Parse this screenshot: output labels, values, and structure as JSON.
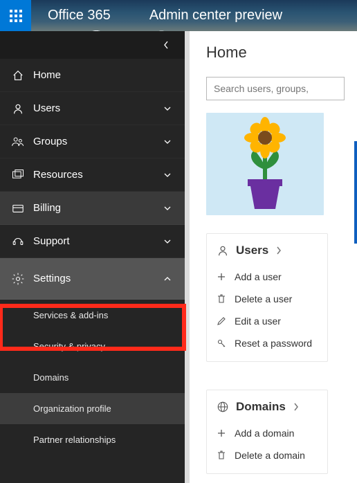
{
  "header": {
    "product": "Office 365",
    "subtitle": "Admin center preview"
  },
  "sidebar": {
    "home": "Home",
    "users": "Users",
    "groups": "Groups",
    "resources": "Resources",
    "billing": "Billing",
    "support": "Support",
    "settings": "Settings",
    "settings_children": {
      "services": "Services & add-ins",
      "security": "Security & privacy",
      "domains": "Domains",
      "org_profile": "Organization profile",
      "partner": "Partner relationships"
    }
  },
  "main": {
    "title": "Home",
    "search_placeholder": "Search users, groups,",
    "users_section": {
      "title": "Users",
      "add": "Add a user",
      "delete": "Delete a user",
      "edit": "Edit a user",
      "reset": "Reset a password"
    },
    "domains_section": {
      "title": "Domains",
      "add": "Add a domain",
      "delete": "Delete a domain"
    }
  }
}
